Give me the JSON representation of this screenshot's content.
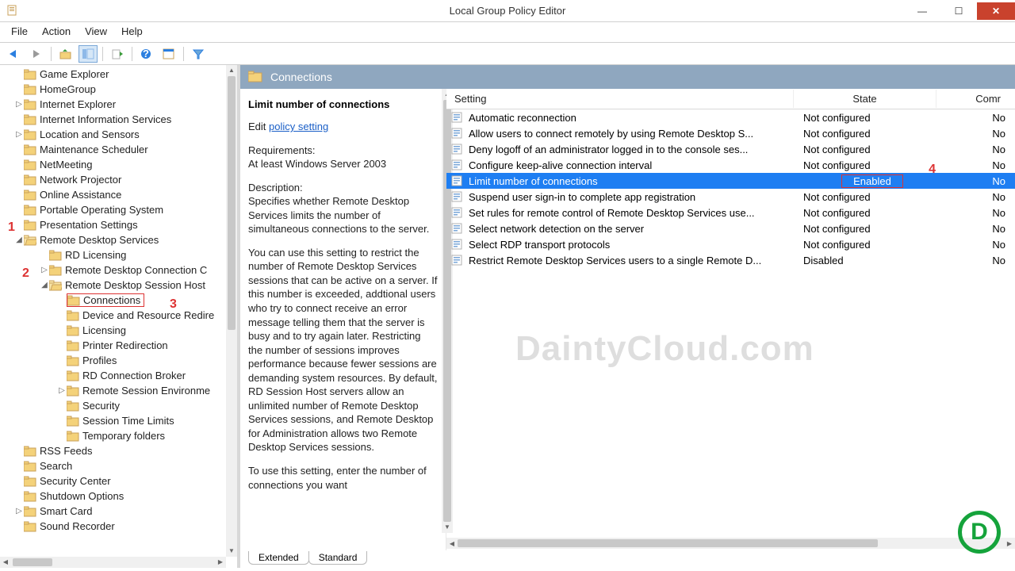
{
  "window": {
    "title": "Local Group Policy Editor"
  },
  "menu": {
    "file": "File",
    "action": "Action",
    "view": "View",
    "help": "Help"
  },
  "tree": [
    {
      "label": "Game Explorer",
      "indent": 1,
      "exp": ""
    },
    {
      "label": "HomeGroup",
      "indent": 1,
      "exp": ""
    },
    {
      "label": "Internet Explorer",
      "indent": 1,
      "exp": "▷"
    },
    {
      "label": "Internet Information Services",
      "indent": 1,
      "exp": ""
    },
    {
      "label": "Location and Sensors",
      "indent": 1,
      "exp": "▷"
    },
    {
      "label": "Maintenance Scheduler",
      "indent": 1,
      "exp": ""
    },
    {
      "label": "NetMeeting",
      "indent": 1,
      "exp": ""
    },
    {
      "label": "Network Projector",
      "indent": 1,
      "exp": ""
    },
    {
      "label": "Online Assistance",
      "indent": 1,
      "exp": ""
    },
    {
      "label": "Portable Operating System",
      "indent": 1,
      "exp": ""
    },
    {
      "label": "Presentation Settings",
      "indent": 1,
      "exp": ""
    },
    {
      "label": "Remote Desktop Services",
      "indent": 1,
      "exp": "◢",
      "open": true
    },
    {
      "label": "RD Licensing",
      "indent": 3,
      "exp": ""
    },
    {
      "label": "Remote Desktop Connection C",
      "indent": 3,
      "exp": "▷"
    },
    {
      "label": "Remote Desktop Session Host",
      "indent": 3,
      "exp": "◢",
      "open": true
    },
    {
      "label": "Connections",
      "indent": 4,
      "exp": "",
      "boxed": true
    },
    {
      "label": "Device and Resource Redire",
      "indent": 4,
      "exp": ""
    },
    {
      "label": "Licensing",
      "indent": 4,
      "exp": ""
    },
    {
      "label": "Printer Redirection",
      "indent": 4,
      "exp": ""
    },
    {
      "label": "Profiles",
      "indent": 4,
      "exp": ""
    },
    {
      "label": "RD Connection Broker",
      "indent": 4,
      "exp": ""
    },
    {
      "label": "Remote Session Environme",
      "indent": 4,
      "exp": "▷"
    },
    {
      "label": "Security",
      "indent": 4,
      "exp": ""
    },
    {
      "label": "Session Time Limits",
      "indent": 4,
      "exp": ""
    },
    {
      "label": "Temporary folders",
      "indent": 4,
      "exp": ""
    },
    {
      "label": "RSS Feeds",
      "indent": 1,
      "exp": ""
    },
    {
      "label": "Search",
      "indent": 1,
      "exp": ""
    },
    {
      "label": "Security Center",
      "indent": 1,
      "exp": ""
    },
    {
      "label": "Shutdown Options",
      "indent": 1,
      "exp": ""
    },
    {
      "label": "Smart Card",
      "indent": 1,
      "exp": "▷"
    },
    {
      "label": "Sound Recorder",
      "indent": 1,
      "exp": ""
    }
  ],
  "header": {
    "title": "Connections"
  },
  "desc": {
    "heading": "Limit number of connections",
    "edit_label": "Edit",
    "link": "policy setting",
    "req_label": "Requirements:",
    "req_text": "At least Windows Server 2003",
    "d_label": "Description:",
    "d1": "Specifies whether Remote Desktop Services limits the number of simultaneous connections to the server.",
    "d2": "You can use this setting to restrict the number of Remote Desktop Services sessions that can be active on a server. If this number is exceeded, addtional users who try to connect receive an error message telling them that the server is busy and to try again later. Restricting the number of sessions improves performance because fewer sessions are demanding system resources. By default, RD Session Host servers allow an unlimited number of Remote Desktop Services sessions, and Remote Desktop for Administration allows two Remote Desktop Services sessions.",
    "d3": "To use this setting, enter the number of connections you want"
  },
  "grid": {
    "h_setting": "Setting",
    "h_state": "State",
    "h_comm": "Comr",
    "rows": [
      {
        "setting": "Automatic reconnection",
        "state": "Not configured",
        "comm": "No"
      },
      {
        "setting": "Allow users to connect remotely by using Remote Desktop S...",
        "state": "Not configured",
        "comm": "No"
      },
      {
        "setting": "Deny logoff of an administrator logged in to the console ses...",
        "state": "Not configured",
        "comm": "No"
      },
      {
        "setting": "Configure keep-alive connection interval",
        "state": "Not configured",
        "comm": "No"
      },
      {
        "setting": "Limit number of connections",
        "state": "Enabled",
        "comm": "No",
        "selected": true,
        "state_boxed": true
      },
      {
        "setting": "Suspend user sign-in to complete app registration",
        "state": "Not configured",
        "comm": "No"
      },
      {
        "setting": "Set rules for remote control of Remote Desktop Services use...",
        "state": "Not configured",
        "comm": "No"
      },
      {
        "setting": "Select network detection on the server",
        "state": "Not configured",
        "comm": "No"
      },
      {
        "setting": "Select RDP transport protocols",
        "state": "Not configured",
        "comm": "No"
      },
      {
        "setting": "Restrict Remote Desktop Services users to a single Remote D...",
        "state": "Disabled",
        "comm": "No"
      }
    ]
  },
  "tabs": {
    "extended": "Extended",
    "standard": "Standard"
  },
  "callouts": {
    "c1": "1",
    "c2": "2",
    "c3": "3",
    "c4": "4"
  },
  "watermark": "DaintyCloud.com",
  "logo": "D"
}
